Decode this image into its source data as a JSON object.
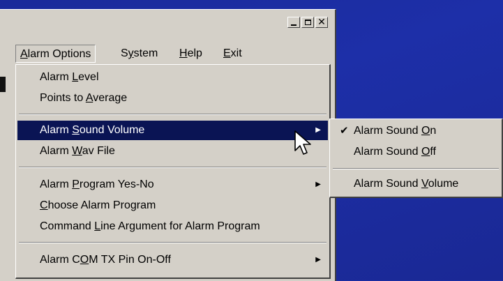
{
  "menubar": {
    "items": [
      {
        "pre": "",
        "u": "A",
        "post": "larm Options"
      },
      {
        "pre": "S",
        "u": "y",
        "post": "stem"
      },
      {
        "pre": "",
        "u": "H",
        "post": "elp"
      },
      {
        "pre": "",
        "u": "E",
        "post": "xit"
      }
    ]
  },
  "dropdown": {
    "items": [
      {
        "pre": "Alarm ",
        "u": "L",
        "post": "evel"
      },
      {
        "pre": "Points to ",
        "u": "A",
        "post": "verage"
      },
      {
        "pre": "Alarm ",
        "u": "S",
        "post": "ound Volume"
      },
      {
        "pre": "Alarm ",
        "u": "W",
        "post": "av File"
      },
      {
        "pre": "Alarm ",
        "u": "P",
        "post": "rogram Yes-No"
      },
      {
        "pre": "",
        "u": "C",
        "post": "hoose Alarm Program"
      },
      {
        "pre": "Command ",
        "u": "L",
        "post": "ine Argument for Alarm Program"
      },
      {
        "pre": "Alarm C",
        "u": "O",
        "post": "M TX Pin On-Off"
      }
    ]
  },
  "submenu": {
    "items": [
      {
        "pre": "Alarm Sound ",
        "u": "O",
        "post": "n"
      },
      {
        "pre": "Alarm Sound ",
        "u": "O",
        "post": "ff"
      },
      {
        "pre": "Alarm Sound ",
        "u": "V",
        "post": "olume"
      }
    ]
  },
  "glyphs": {
    "check": "✔",
    "arrow": "▶",
    "close": "✕"
  },
  "colors": {
    "highlight": "#0a1454",
    "desktop": "#1d2fa8",
    "chrome": "#d4d0c8"
  }
}
